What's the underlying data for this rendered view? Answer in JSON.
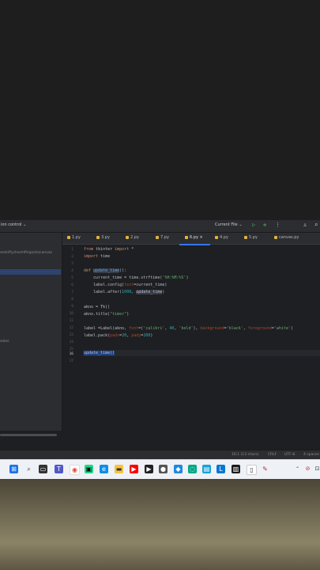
{
  "titlebar": {
    "version_control": "ion control ⌄",
    "run_config": "Current File ⌄"
  },
  "sidebar": {
    "path": "ents\\PycharmProjects\\canvas",
    "consoles": "soles"
  },
  "tabs": [
    {
      "label": "1.py"
    },
    {
      "label": "3.py"
    },
    {
      "label": "2.py"
    },
    {
      "label": "7.py"
    },
    {
      "label": "6.py ×"
    },
    {
      "label": "4.py"
    },
    {
      "label": "5.py"
    },
    {
      "label": "canvas.py"
    }
  ],
  "code": {
    "line_numbers": [
      "1",
      "2",
      "3",
      "4",
      "5",
      "6",
      "7",
      "8",
      "9",
      "10",
      "11",
      "12",
      "13",
      "14",
      "15",
      "16",
      "17"
    ],
    "lines": {
      "l1": {
        "a": "from",
        "b": " tkinter ",
        "c": "import",
        "d": " *"
      },
      "l2": {
        "a": "import",
        "b": " time"
      },
      "l4": {
        "a": "def ",
        "b": "update_time",
        "c": "():"
      },
      "l5": {
        "a": "    current_time = time.strftime(",
        "b": "'%H:%M:%S'",
        "c": ")"
      },
      "l6": {
        "a": "    label.config(",
        "b": "text",
        "c": "=current_time)"
      },
      "l7": {
        "a": "    label.after(",
        "b": "1000",
        "c": ", ",
        "d": "update_time",
        "e": ")"
      },
      "l9": {
        "a": "akno = Tk()"
      },
      "l10": {
        "a": "akno.title(",
        "b": "\"timer\"",
        "c": ")"
      },
      "l12a": {
        "a": "label =Label(akno, ",
        "b": "font",
        "c": "=(",
        "d": "'calibri'",
        "e": ", ",
        "f": "40",
        "g": ", ",
        "h": "'bold'",
        "i": "), ",
        "j": "background",
        "k": "=",
        "l": "'black'",
        "m": ", ",
        "n": "foreground",
        "o": "=",
        "p": "'white'",
        "q": ")"
      },
      "l13": {
        "a": "label.pack(",
        "b": "padx",
        "c": "=",
        "d": "20",
        "e": ", ",
        "f": "pady",
        "g": "=",
        "h": "200",
        "i": ")"
      },
      "l16": {
        "a": "update_time()"
      }
    }
  },
  "statusbar": {
    "position": "16:1 (13 chars)",
    "line_sep": "CRLF",
    "encoding": "UTF-8",
    "indent": "4 spaces"
  },
  "colors": {
    "accent": "#3574f0",
    "keyword": "#cf8e6d",
    "function": "#56a8f5",
    "string": "#6aab73",
    "number": "#2aacb8"
  }
}
